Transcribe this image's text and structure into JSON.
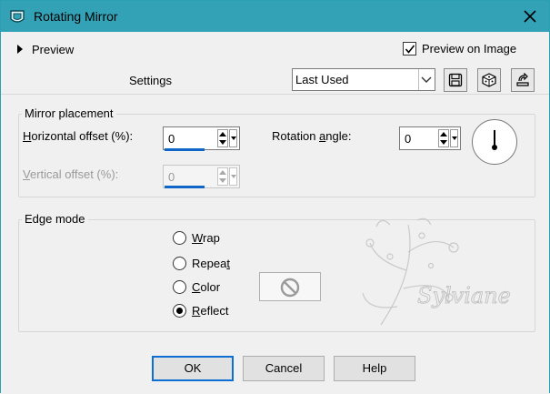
{
  "window": {
    "title": "Rotating Mirror"
  },
  "top": {
    "preview_label": "Preview",
    "preview_on_image_label": "Preview on Image",
    "preview_on_image_checked": true,
    "settings_label": "Settings",
    "settings_value": "Last Used"
  },
  "mirror_placement": {
    "title": "Mirror placement",
    "horizontal_offset_label": "orizontal offset (%):",
    "horizontal_offset_hotkey": "H",
    "horizontal_offset_value": "0",
    "vertical_offset_label": "ertical offset (%):",
    "vertical_offset_hotkey": "V",
    "vertical_offset_value": "0",
    "rotation_angle_label_pre": "Rotation ",
    "rotation_angle_hotkey": "a",
    "rotation_angle_label_post": "ngle:",
    "rotation_angle_value": "0"
  },
  "edge_mode": {
    "title": "Edge mode",
    "options": [
      {
        "hotkey": "W",
        "rest": "rap",
        "checked": false
      },
      {
        "hotkey": "",
        "pre": "Repea",
        "hotkey2": "t",
        "checked": false
      },
      {
        "hotkey": "C",
        "rest": "olor",
        "checked": false
      },
      {
        "hotkey": "R",
        "rest": "eflect",
        "checked": true
      }
    ],
    "reflect_rest": "eflect",
    "wrap_rest": "rap",
    "repeat_pre": "Repea",
    "repeat_hotkey": "t",
    "color_rest": "olor"
  },
  "watermark_text": "Sylviane",
  "buttons": {
    "ok": "OK",
    "cancel": "Cancel",
    "help": "Help"
  },
  "colors": {
    "titlebar": "#34a2b6",
    "accent": "#1066c8"
  }
}
